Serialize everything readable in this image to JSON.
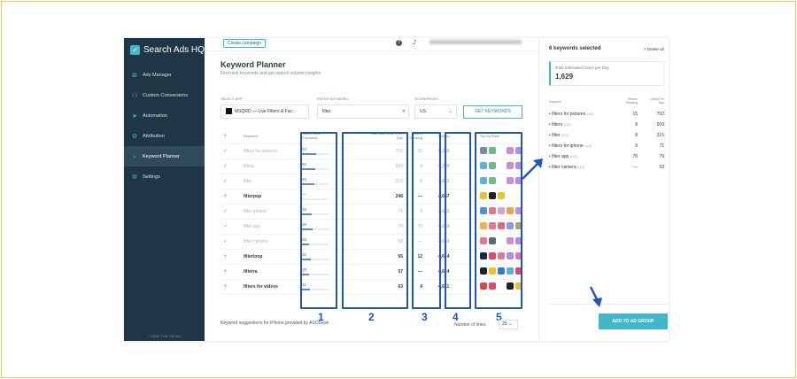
{
  "app": {
    "name": "Search Ads HQ",
    "brand_color": "#3fb9c9",
    "sidebar_color": "#1f3646"
  },
  "sidebar": {
    "items": [
      {
        "label": "Ads Manager",
        "icon": "plus-square-icon"
      },
      {
        "label": "Custom Conversions",
        "icon": "users-icon"
      },
      {
        "label": "Automation",
        "icon": "paper-plane-icon"
      },
      {
        "label": "Attribution",
        "icon": "gear-icon"
      },
      {
        "label": "Keyword Planner",
        "icon": "search-icon",
        "active": true
      },
      {
        "label": "Settings",
        "icon": "settings-icon"
      }
    ],
    "hide_label": "‹ HIDE THE MENU"
  },
  "topbar": {
    "create_label": "Create campaign"
  },
  "main": {
    "title": "Keyword Planner",
    "subtitle": "Find new keywords and get search volume insights",
    "select_app_label": "SELECT APP",
    "selected_app": "MSQRD — Live Filters & Fac...",
    "enter_keyword_label": "ENTER KEYWORD",
    "keyword_value": "filter",
    "storefront_label": "STOREFRONT",
    "storefront_value": "US",
    "get_keywords_label": "GET KEYWORDS",
    "columns": {
      "keyword": "Keyword",
      "popularity": "Search Ads Popularity",
      "users": "Estimated Users per Day",
      "ranking": "Search Ranking",
      "priority": "Priority",
      "top": "Top by Rank"
    },
    "rows": [
      {
        "keyword": "filters for pictures",
        "popularity": "52",
        "pop_frac": 0.52,
        "users": "702",
        "ranking": "15",
        "priority": "5,393",
        "added": true,
        "icons": [
          "#7a8c99",
          "#6dbb8c",
          "none",
          "#c98fd6",
          "#b48be6"
        ]
      },
      {
        "keyword": "filters",
        "popularity": "50",
        "pop_frac": 0.5,
        "users": "509",
        "ranking": "8",
        "priority": "5,206",
        "added": true,
        "icons": [
          "#5ab0d8",
          "#6dbb8c",
          "none",
          "#c98fd6",
          "#b48be6"
        ]
      },
      {
        "keyword": "filter",
        "popularity": "45",
        "pop_frac": 0.45,
        "users": "215",
        "ranking": "8",
        "priority": "4,821",
        "added": true,
        "icons": [
          "#5ab0d8",
          "#6dbb8c",
          "none",
          "#c98fd6",
          "#b48be6"
        ]
      },
      {
        "keyword": "filterpop",
        "popularity": "—",
        "pop_frac": 0,
        "users": "246",
        "ranking": "—",
        "priority": "4,657",
        "added": false,
        "icons": [
          "#e8c12b",
          "#222222",
          "#e8c12b"
        ]
      },
      {
        "keyword": "filter iphone",
        "popularity": "35",
        "pop_frac": 0.35,
        "users": "71",
        "ranking": "9",
        "priority": "4,622",
        "added": true,
        "icons": [
          "#4a8fd6",
          "#e07a8a",
          "#d9a0c8",
          "#e9a64a",
          "#c98fd6"
        ]
      },
      {
        "keyword": "filter app",
        "popularity": "39",
        "pop_frac": 0.39,
        "users": "79",
        "ranking": "70",
        "priority": "4,618",
        "added": true,
        "icons": [
          "#f2b04a",
          "#e07a8a",
          "#e06a7a",
          "#8a9be0",
          "#b0a070"
        ]
      },
      {
        "keyword": "filter camera",
        "popularity": "26",
        "pop_frac": 0.26,
        "users": "53",
        "ranking": "—",
        "priority": "4,614",
        "added": true,
        "icons": [
          "#e07a8a",
          "#5a6a78",
          "none",
          "#c98fd6",
          "#b48be6"
        ]
      },
      {
        "keyword": "filterloop",
        "popularity": "32",
        "pop_frac": 0.32,
        "users": "65",
        "ranking": "12",
        "priority": "4,614",
        "added": false,
        "icons": [
          "#222244",
          "#e04a6a",
          "#e07a8a",
          "#b48be6",
          "#d67ab8"
        ]
      },
      {
        "keyword": "filterra",
        "popularity": "28",
        "pop_frac": 0.28,
        "users": "57",
        "ranking": "—",
        "priority": "4,614",
        "added": false,
        "icons": [
          "#222222",
          "#e8c12b",
          "#3a78d6",
          "#5ab0d8",
          "#e04a6a"
        ]
      },
      {
        "keyword": "filters for videos",
        "popularity": "31",
        "pop_frac": 0.31,
        "users": "63",
        "ranking": "4",
        "priority": "4,611",
        "added": false,
        "icons": [
          "#d44a4a",
          "#e04a6a",
          "none",
          "#222222",
          "#e8c12b"
        ]
      }
    ],
    "annotations": [
      "1",
      "2",
      "3",
      "4",
      "5"
    ],
    "footer_note": "Keyword suggestions for iPhone provided by ",
    "footer_brand": "ASODesk",
    "lines_label": "Number of lines:",
    "lines_value": "25"
  },
  "panel": {
    "title": "6 keywords selected",
    "delete_all": "× Delete all",
    "total_label": "Total Estimated Users per Day",
    "total_value": "1,629",
    "col_keyword": "Keyword",
    "col_ranking": "Search Ranking",
    "col_users": "Users Per Day",
    "selected": [
      {
        "keyword": "filters for pictures",
        "cc": "(US)",
        "ranking": "15",
        "users": "702"
      },
      {
        "keyword": "filters",
        "cc": "(US)",
        "ranking": "8",
        "users": "509"
      },
      {
        "keyword": "filter",
        "cc": "(US)",
        "ranking": "8",
        "users": "215"
      },
      {
        "keyword": "filters for iphone",
        "cc": "(US)",
        "ranking": "9",
        "users": "71"
      },
      {
        "keyword": "filter app",
        "cc": "(US)",
        "ranking": "70",
        "users": "79"
      },
      {
        "keyword": "filter camera",
        "cc": "(US)",
        "ranking": "—",
        "users": "53"
      }
    ],
    "add_label": "ADD TO AD GROUP"
  }
}
